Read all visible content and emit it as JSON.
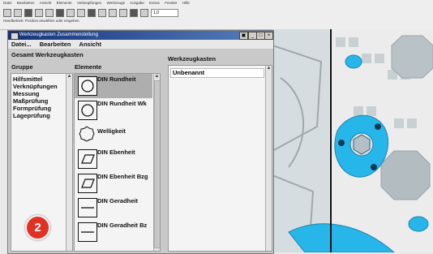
{
  "app": {
    "menu": [
      "Datei",
      "Bearbeiten",
      "Ansicht",
      "Elemente",
      "Verknüpfungen",
      "Werkzeuge",
      "Ausgabe",
      "Extras",
      "Fenster",
      "Hilfe"
    ],
    "toolbar_field": "1,0",
    "status": "Handbetrieb: Position anwählen oder eingeben"
  },
  "dialog": {
    "title": "Werkzeugkasten Zusammenstellung",
    "menu": [
      "Datei...",
      "Bearbeiten",
      "Ansicht"
    ],
    "gesamt_label": "Gesamt Werkzeugkasten",
    "gruppe_label": "Gruppe",
    "elemente_label": "Elemente",
    "werkzeugkasten_label": "Werkzeugkasten",
    "groups": [
      "Hilfsmittel",
      "Verknüpfungen",
      "Messung",
      "Maßprüfung",
      "Formprüfung",
      "Lageprüfung"
    ],
    "elements": [
      "DIN Rundheit",
      "DIN Rundheit Wk",
      "Welligkeit",
      "DIN Ebenheit",
      "DIN Ebenheit Bzg",
      "DIN Geradheit",
      "DIN Geradheit Bz"
    ],
    "toolbox_item": "Unbenannt"
  },
  "badge": {
    "number": "2",
    "color": "#e23123"
  },
  "colors": {
    "title_start": "#15337a",
    "title_end": "#587fbd",
    "part_blue": "#27b6ea"
  }
}
